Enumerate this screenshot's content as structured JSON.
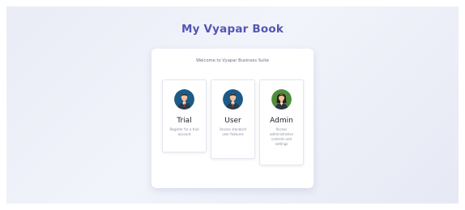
{
  "app": {
    "title": "My Vyapar Book"
  },
  "card": {
    "welcome_text": "Welcome to Vyapar Business Suite"
  },
  "roles": [
    {
      "name": "Trial",
      "description": "Register for a trial account",
      "icon": "male-user-avatar-icon",
      "avatar_bg": "#1d5a86"
    },
    {
      "name": "User",
      "description": "Access standard user features",
      "icon": "male-user-avatar-icon",
      "avatar_bg": "#1d5a86"
    },
    {
      "name": "Admin",
      "description": "Access administrative controls and settings",
      "icon": "female-user-avatar-icon",
      "avatar_bg": "#4e8e3b"
    }
  ],
  "colors": {
    "accent": "#5256b5",
    "background": "#eceff7"
  }
}
